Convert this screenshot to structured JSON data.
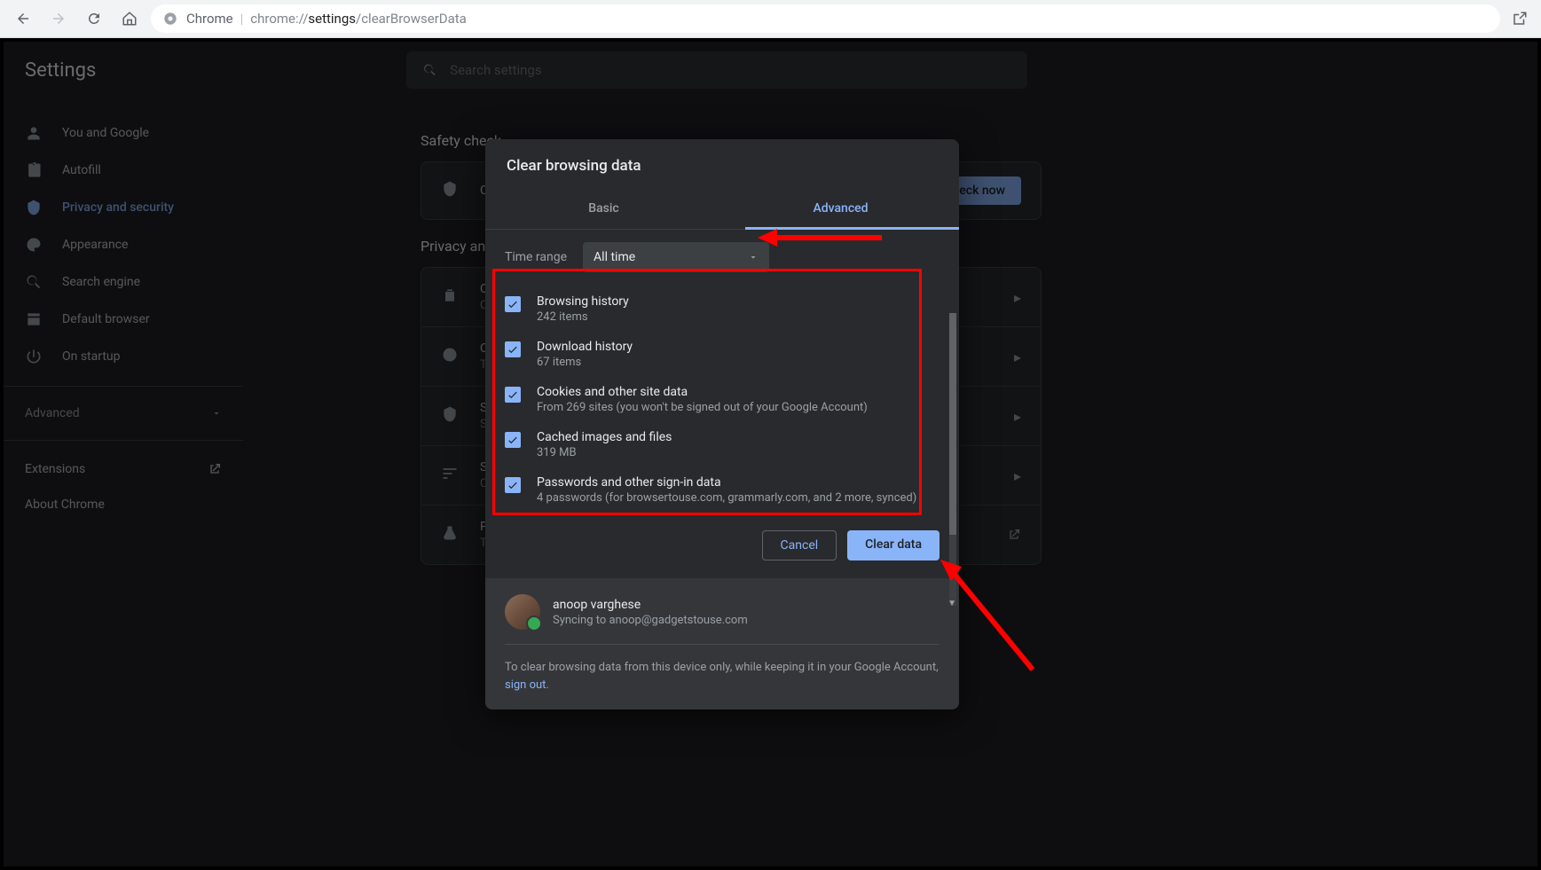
{
  "browser": {
    "site_label": "Chrome",
    "url_prefix": "chrome://",
    "url_bold": "settings",
    "url_rest": "/clearBrowserData"
  },
  "app": {
    "title": "Settings",
    "search_placeholder": "Search settings"
  },
  "sidebar": {
    "items": [
      {
        "label": "You and Google"
      },
      {
        "label": "Autofill"
      },
      {
        "label": "Privacy and security"
      },
      {
        "label": "Appearance"
      },
      {
        "label": "Search engine"
      },
      {
        "label": "Default browser"
      },
      {
        "label": "On startup"
      }
    ],
    "advanced": "Advanced",
    "extensions": "Extensions",
    "about": "About Chrome"
  },
  "main": {
    "safety_header": "Safety check",
    "privacy_header": "Privacy and security",
    "safety_row": {
      "title": "Chro",
      "btn": "eck now"
    },
    "rows": [
      {
        "title": "Clear",
        "sub": "Clear"
      },
      {
        "title": "Cook",
        "sub": "Third"
      },
      {
        "title": "Secu",
        "sub": "Safe"
      },
      {
        "title": "Site S",
        "sub": "Cont"
      },
      {
        "title": "Priva",
        "sub": "Trial"
      }
    ]
  },
  "dialog": {
    "title": "Clear browsing data",
    "tab_basic": "Basic",
    "tab_advanced": "Advanced",
    "time_range_label": "Time range",
    "time_range_value": "All time",
    "items": [
      {
        "title": "Browsing history",
        "sub": "242 items"
      },
      {
        "title": "Download history",
        "sub": "67 items"
      },
      {
        "title": "Cookies and other site data",
        "sub": "From 269 sites (you won't be signed out of your Google Account)"
      },
      {
        "title": "Cached images and files",
        "sub": "319 MB"
      },
      {
        "title": "Passwords and other sign-in data",
        "sub": "4 passwords (for browsertouse.com, grammarly.com, and 2 more, synced)"
      }
    ],
    "cancel": "Cancel",
    "clear": "Clear data",
    "profile_name": "anoop varghese",
    "profile_sync": "Syncing to anoop@gadgetstouse.com",
    "footer_text": "To clear browsing data from this device only, while keeping it in your Google Account, ",
    "footer_link": "sign out",
    "footer_dot": "."
  }
}
